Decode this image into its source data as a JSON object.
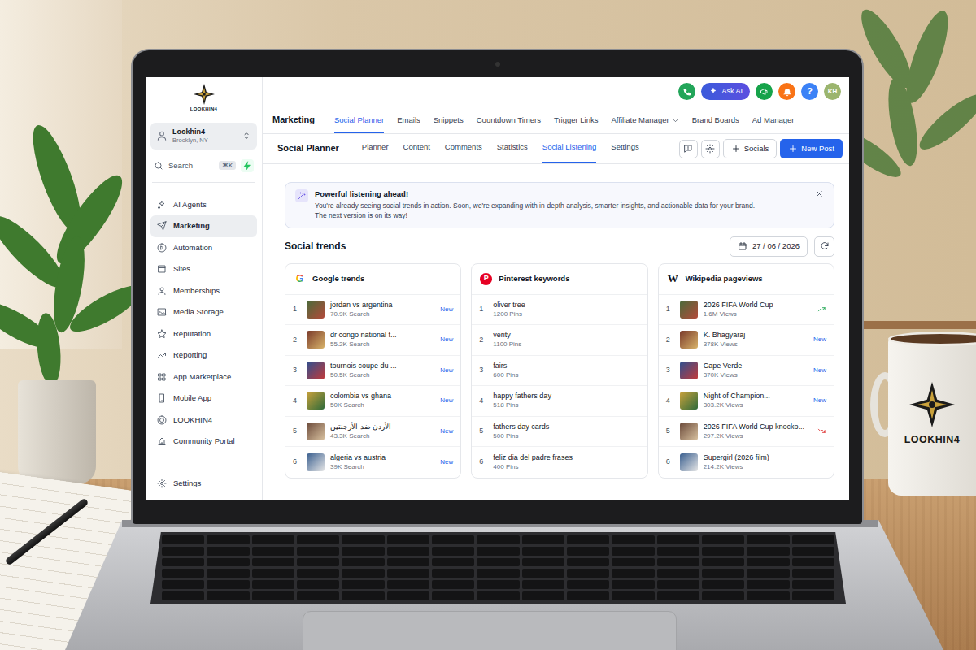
{
  "brand": {
    "name": "LOOKHIN4"
  },
  "account": {
    "name": "Lookhin4",
    "location": "Brooklyn, NY"
  },
  "search": {
    "label": "Search",
    "shortcut": "⌘K"
  },
  "sidebar": {
    "items": [
      {
        "label": "AI Agents",
        "selected": false
      },
      {
        "label": "Marketing",
        "selected": true
      },
      {
        "label": "Automation",
        "selected": false
      },
      {
        "label": "Sites",
        "selected": false
      },
      {
        "label": "Memberships",
        "selected": false
      },
      {
        "label": "Media Storage",
        "selected": false
      },
      {
        "label": "Reputation",
        "selected": false
      },
      {
        "label": "Reporting",
        "selected": false
      },
      {
        "label": "App Marketplace",
        "selected": false
      },
      {
        "label": "Mobile App",
        "selected": false
      },
      {
        "label": "LOOKHIN4",
        "selected": false
      },
      {
        "label": "Community Portal",
        "selected": false
      }
    ],
    "footer": {
      "label": "Settings",
      "selected": false
    }
  },
  "header": {
    "ask_ai": "Ask AI",
    "help": "?",
    "avatar": "KH"
  },
  "section": {
    "title": "Marketing"
  },
  "main_tabs": [
    {
      "label": "Social Planner",
      "selected": true,
      "kind": "link"
    },
    {
      "label": "Emails",
      "selected": false,
      "kind": "link"
    },
    {
      "label": "Snippets",
      "selected": false,
      "kind": "link"
    },
    {
      "label": "Countdown Timers",
      "selected": false,
      "kind": "link"
    },
    {
      "label": "Trigger Links",
      "selected": false,
      "kind": "link"
    },
    {
      "label": "Affiliate Manager",
      "selected": false,
      "kind": "dropdown"
    },
    {
      "label": "Brand Boards",
      "selected": false,
      "kind": "link"
    },
    {
      "label": "Ad Manager",
      "selected": false,
      "kind": "link"
    }
  ],
  "sub_nav": {
    "title": "Social Planner",
    "tabs": [
      {
        "label": "Planner",
        "selected": false
      },
      {
        "label": "Content",
        "selected": false
      },
      {
        "label": "Comments",
        "selected": false
      },
      {
        "label": "Statistics",
        "selected": false
      },
      {
        "label": "Social Listening",
        "selected": true
      },
      {
        "label": "Settings",
        "selected": false
      }
    ],
    "socials": "Socials",
    "new_post": "New Post"
  },
  "banner": {
    "title": "Powerful listening ahead!",
    "lines": [
      "You're already seeing social trends in action. Soon, we're expanding with in-depth analysis, smarter insights, and actionable data for your brand.",
      "The next version is on its way!"
    ]
  },
  "trends": {
    "title": "Social trends",
    "date": "27 / 06 / 2026"
  },
  "cards": [
    {
      "title": "Google trends",
      "kind": "google",
      "icon": "G",
      "items": [
        {
          "rank": "1",
          "label": "jordan vs argentina",
          "count": "70.9K Search",
          "kind": "new",
          "badge": "New"
        },
        {
          "rank": "2",
          "label": "dr congo national f...",
          "count": "55.2K Search",
          "kind": "new",
          "badge": "New"
        },
        {
          "rank": "3",
          "label": "tournois coupe du ...",
          "count": "50.5K Search",
          "kind": "new",
          "badge": "New"
        },
        {
          "rank": "4",
          "label": "colombia vs ghana",
          "count": "50K Search",
          "kind": "new",
          "badge": "New"
        },
        {
          "rank": "5",
          "label": "الأردن ضد الأرجنتين",
          "count": "43.3K Search",
          "kind": "new",
          "badge": "New"
        },
        {
          "rank": "6",
          "label": "algeria vs austria",
          "count": "39K Search",
          "kind": "new",
          "badge": "New"
        }
      ]
    },
    {
      "title": "Pinterest keywords",
      "kind": "pinterest",
      "icon": "P",
      "items": [
        {
          "rank": "1",
          "label": "oliver tree",
          "count": "1200 Pins",
          "kind": "plain"
        },
        {
          "rank": "2",
          "label": "verity",
          "count": "1100 Pins",
          "kind": "plain"
        },
        {
          "rank": "3",
          "label": "fairs",
          "count": "600 Pins",
          "kind": "plain"
        },
        {
          "rank": "4",
          "label": "happy fathers day",
          "count": "518 Pins",
          "kind": "plain"
        },
        {
          "rank": "5",
          "label": "fathers day cards",
          "count": "500 Pins",
          "kind": "plain"
        },
        {
          "rank": "6",
          "label": "feliz dia del padre frases",
          "count": "400 Pins",
          "kind": "plain"
        }
      ]
    },
    {
      "title": "Wikipedia pageviews",
      "kind": "wikipedia",
      "icon": "W",
      "items": [
        {
          "rank": "1",
          "label": "2026 FIFA World Cup",
          "count": "1.6M Views",
          "kind": "up"
        },
        {
          "rank": "2",
          "label": "K. Bhagyaraj",
          "count": "378K Views",
          "kind": "new",
          "badge": "New"
        },
        {
          "rank": "3",
          "label": "Cape Verde",
          "count": "370K Views",
          "kind": "new",
          "badge": "New"
        },
        {
          "rank": "4",
          "label": "Night of Champion...",
          "count": "303.2K Views",
          "kind": "new",
          "badge": "New"
        },
        {
          "rank": "5",
          "label": "2026 FIFA World Cup knocko...",
          "count": "297.2K Views",
          "kind": "down"
        },
        {
          "rank": "6",
          "label": "Supergirl (2026 film)",
          "count": "214.2K Views",
          "kind": "plain"
        }
      ]
    }
  ],
  "mug": {
    "label": "LOOKHIN4"
  }
}
